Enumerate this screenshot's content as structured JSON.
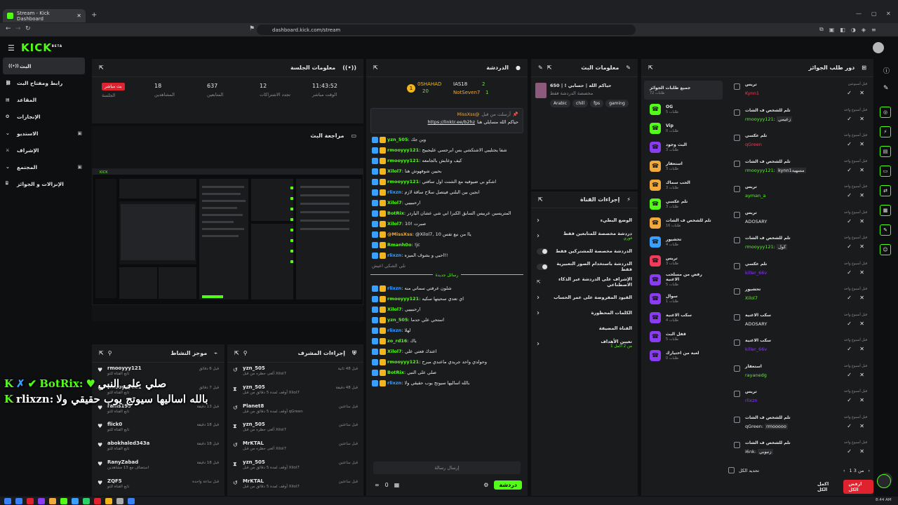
{
  "browser": {
    "tab_title": "Stream - Kick Dashboard",
    "url": "dashboard.kick.com/stream"
  },
  "brand": {
    "logo": "KICK",
    "beta": "BETA",
    "accent": "#53fc18"
  },
  "sidebar": {
    "items": [
      {
        "label": "البث",
        "icon": "broadcast-icon"
      },
      {
        "label": "رابط ومفتاح البث",
        "icon": "link-icon"
      },
      {
        "label": "المقاعد",
        "icon": "seat-icon"
      },
      {
        "label": "الإنجازات",
        "icon": "achievement-icon"
      },
      {
        "label": "الاستديو",
        "icon": "studio-icon"
      },
      {
        "label": "الإشراف",
        "icon": "moderation-icon"
      },
      {
        "label": "المجتمع",
        "icon": "community-icon"
      },
      {
        "label": "الإنزالات و الجوائز",
        "icon": "gift-icon"
      }
    ]
  },
  "session": {
    "title": "معلومات الجلسة",
    "live_badge": "بث مباشر",
    "stats": [
      {
        "label": "الجلسة",
        "value": ""
      },
      {
        "label": "المشاهدين",
        "value": "18"
      },
      {
        "label": "المتابعين",
        "value": "637"
      },
      {
        "label": "تجدد الاشتراكات",
        "value": "12"
      },
      {
        "label": "الوقت مباشر",
        "value": "11:43:52"
      }
    ]
  },
  "preview": {
    "title": "مراجعة البث"
  },
  "activity": {
    "title": "موجز النشاط",
    "items": [
      {
        "user": "rmooyyy121",
        "sub": "تابع القناة للتو",
        "time": "قبل 6 دقائق"
      },
      {
        "user": "rmooyyy121",
        "sub": "تابع القناة للتو",
        "time": "قبل 7 دقائق"
      },
      {
        "user": "rallis199",
        "sub": "تابع القناة للتو",
        "time": "قبل 13 دقيقة"
      },
      {
        "user": "flick0",
        "sub": "تابع القناة للتو",
        "time": "قبل 18 دقيقة"
      },
      {
        "user": "abokhaled343a",
        "sub": "تابع القناة للتو",
        "time": "قبل 18 دقيقة"
      },
      {
        "user": "RanyZabad",
        "sub": "استضاف مع 13 مشاهدين",
        "time": "قبل 18 دقيقة"
      },
      {
        "user": "ZQF5",
        "sub": "تابع القناة للتو",
        "time": "قبل ساعة واحدة"
      }
    ]
  },
  "mod_actions": {
    "title": "إجراءات المشرف",
    "items": [
      {
        "user": "yzn_505",
        "sub": "ألغى حظره من قبل Xilol7",
        "time": "قبل 48 ثانية"
      },
      {
        "user": "yzn_505",
        "sub": "أوقف لمدة 5 دقائق من قبل Xilol7",
        "time": "قبل 48 دقيقة"
      },
      {
        "user": "Planet8",
        "sub": "أوقف لمدة 5 دقائق من قبل qGreen",
        "time": "قبل ساعتين"
      },
      {
        "user": "yzn_505",
        "sub": "ألغى حظره من قبل Xilol7",
        "time": "قبل ساعتين"
      },
      {
        "user": "MrKTAL",
        "sub": "ألغى حظره من قبل Xilol7",
        "time": "قبل ساعتين"
      },
      {
        "user": "yzn_505",
        "sub": "أوقف لمدة 5 دقائق من قبل Xilol7",
        "time": "قبل ساعتين"
      },
      {
        "user": "MrKTAL",
        "sub": "أوقف لمدة 5 دقائق من قبل Xilol7",
        "time": "قبل ساعتين"
      }
    ]
  },
  "chat": {
    "title": "الدردشة",
    "leaders": [
      {
        "name": "0SHAHAD",
        "count": "20"
      },
      {
        "name": "IAS18",
        "count": "2"
      },
      {
        "name": "NotSeven7",
        "count": "1"
      }
    ],
    "pinned_user": "@MissXss",
    "pinned_prefix": "أرسلت من قبل",
    "pinned_text": "حياكم الله مسايلي هنا",
    "pinned_link": "https://linktr.ee/b2hz",
    "new_messages": "رسائل جديدة",
    "messages": [
      {
        "user": "yzn_505",
        "text": "وين جك",
        "color": "#53fc18"
      },
      {
        "user": "rmooyyy121",
        "text": "شفا يجتليبي الاشتكشي بس ابرحسي عليجيبج",
        "color": "#53fc18"
      },
      {
        "user": "rmooyyy121",
        "text": "كيف وعابش بالجامعه",
        "color": "#53fc18"
      },
      {
        "user": "Xilol7",
        "text": "بحيين شوفهوش هنا",
        "color": "#53fc18"
      },
      {
        "user": "rmooyyy121",
        "text": "اشكو بي ضيوفيه مع الشنت اول سافتي",
        "color": "#53fc18"
      },
      {
        "user": "rlixzn",
        "text": "انجين بين البلني فيتصل سلاح ساقة لازم",
        "color": "#3aa0ff"
      },
      {
        "user": "Xilol7",
        "text": "ارحبيييي",
        "color": "#53fc18"
      },
      {
        "user": "BotRix",
        "text": "المتريسين عربيس السابق الكبرا ابي شي عشان الياردر",
        "color": "#53fc18"
      },
      {
        "user": "Xilol7",
        "text": "صبرت !10",
        "color": "#53fc18"
      },
      {
        "user": "@MissXss",
        "text": "@Xilol7, 10 ياا من نبع تفس",
        "color": "#f2a93b"
      },
      {
        "user": "Rmanh0o",
        "text": "!jc",
        "color": "#53fc18"
      },
      {
        "user": "rlixzn",
        "text": "احبي و بشوف الميزه!!",
        "color": "#3aa0ff"
      },
      {
        "user": "",
        "text": "نلي الشكي اعيش",
        "color": "#8c8f93"
      },
      {
        "user": "rlixzn",
        "text": "شلون عرفتي سماتي منه",
        "color": "#3aa0ff"
      },
      {
        "user": "rmooyyy121",
        "text": "اي تعدي سحيتها سكيه",
        "color": "#53fc18"
      },
      {
        "user": "Xilol7",
        "text": "ارحبيييي",
        "color": "#53fc18"
      },
      {
        "user": "yzn_505",
        "text": "استحي علي حدما",
        "color": "#53fc18"
      },
      {
        "user": "rlixzn",
        "text": "لهلا",
        "color": "#3aa0ff"
      },
      {
        "user": "zo_rd16",
        "text": "باك",
        "color": "#53fc18"
      },
      {
        "user": "Xilol7",
        "text": "اعتذك فعتي علي",
        "color": "#53fc18"
      },
      {
        "user": "rmooyyy121",
        "text": "وحولدي واحد جريدي ماعندي مبرح",
        "color": "#53fc18"
      },
      {
        "user": "BotRix",
        "text": "صلي على النبي",
        "color": "#53fc18"
      },
      {
        "user": "rlixzn",
        "text": "بالله اساليها سيوتج يوب حقيقي ولا",
        "color": "#3aa0ff"
      }
    ],
    "input_placeholder": "إرسال رسالة",
    "send_label": "دردشة",
    "footer_count": "0"
  },
  "stream_info": {
    "title": "معلومات البث",
    "stream_title": "حياكم الله | حسابي ! | 650",
    "category": "مخصصة الدردشة فقط",
    "tags": [
      "Arabic",
      "chill",
      "fps",
      "gaming"
    ]
  },
  "channel_actions": {
    "title": "إجراءات القناة",
    "items": [
      {
        "label": "الوضع البطيء",
        "sub": "",
        "control": "chevron"
      },
      {
        "label": "دردشة مخصصة للمتابعين فقط",
        "sub": "فوري",
        "control": "chevron"
      },
      {
        "label": "الدردشة مخصصة للمشتركين فقط",
        "sub": "",
        "control": "toggle"
      },
      {
        "label": "الدردشة باستخدام الصور التعبيرية فقط",
        "sub": "",
        "control": "toggle"
      },
      {
        "label": "الإشراف على الدردشة عبر الذكاء الاصطناعي",
        "sub": "",
        "control": "external"
      },
      {
        "label": "القيود المفروضة على عمر الحساب",
        "sub": "",
        "control": "chevron"
      },
      {
        "label": "الكلمات المحظورة",
        "sub": "",
        "control": "chevron"
      },
      {
        "label": "القناة المضيفة",
        "sub": "",
        "control": "none"
      },
      {
        "label": "تعيين الأهداف",
        "sub": "1 من 2 أكمل",
        "control": "chevron"
      }
    ]
  },
  "queue": {
    "title": "دور طلب الجوائز",
    "categories": [
      {
        "label": "جميع طلبات الجوائز",
        "sub": "72 طلبات",
        "color": "#2a2c2f"
      },
      {
        "label": "OG",
        "sub": "5 طلبات",
        "color": "#53fc18"
      },
      {
        "label": "Vip",
        "sub": "0 طلبات",
        "color": "#53fc18"
      },
      {
        "label": "البث وجود",
        "sub": "3 طلبات",
        "color": "#8a3cf0"
      },
      {
        "label": "استغفار",
        "sub": "3 طلبات",
        "color": "#f2a93b"
      },
      {
        "label": "الحب سماك",
        "sub": "3 طلبات",
        "color": "#f2a93b"
      },
      {
        "label": "تلم عكسي",
        "sub": "3 طلبات",
        "color": "#53fc18"
      },
      {
        "label": "تلم للشخص ف الشات",
        "sub": "16 طلبات",
        "color": "#f2a93b"
      },
      {
        "label": "تحشيور",
        "sub": "4 طلبات",
        "color": "#3aa0ff"
      },
      {
        "label": "تريس",
        "sub": "3 طلبات",
        "color": "#f23b5a"
      },
      {
        "label": "رفض من مسلحب الاغنية",
        "sub": "5 طلبات",
        "color": "#8a3cf0"
      },
      {
        "label": "سوال",
        "sub": "1 طلبات",
        "color": "#8a3cf0"
      },
      {
        "label": "سكب الاغنية",
        "sub": "4 طلبات",
        "color": "#8a3cf0"
      },
      {
        "label": "قفل البث",
        "sub": "5 طلبات",
        "color": "#8a3cf0"
      },
      {
        "label": "لعبة من اختيارك",
        "sub": "0 طلبات",
        "color": "#8a3cf0"
      }
    ],
    "requests": [
      {
        "title": "تريس",
        "user": "Kynn1",
        "user_color": "#f23b5a",
        "extra": "",
        "time": "قبل أسبوعين"
      },
      {
        "title": "تلم للشخص ف الشات",
        "user": "rmooyyy121",
        "user_color": "#53fc18",
        "extra": "زعيمي",
        "time": "قبل أسبوع واحد"
      },
      {
        "title": "تلم عكسي",
        "user": "qGreen",
        "user_color": "#f23b5a",
        "extra": "",
        "time": "قبل أسبوع واحد"
      },
      {
        "title": "تلم للشخص ف الشات",
        "user": "rmooyyy121",
        "user_color": "#53fc18",
        "extra": "kynn1مسهيه",
        "time": "قبل أسبوع واحد"
      },
      {
        "title": "تريس",
        "user": "ayman_a",
        "user_color": "#53fc18",
        "extra": "",
        "time": "قبل أسبوع واحد"
      },
      {
        "title": "تريس",
        "user": "ADOSARY",
        "user_color": "#e8e8e8",
        "extra": "",
        "time": "قبل أسبوع واحد"
      },
      {
        "title": "تلم للشخص ف الشات",
        "user": "rmooyyy121",
        "user_color": "#53fc18",
        "extra": "كول",
        "time": "قبل أسبوع واحد"
      },
      {
        "title": "تلم عكسي",
        "user": "killer_66v",
        "user_color": "#8a3cf0",
        "extra": "",
        "time": "قبل أسبوع واحد"
      },
      {
        "title": "تحشيور",
        "user": "Xilol7",
        "user_color": "#53fc18",
        "extra": "",
        "time": "قبل أسبوع واحد"
      },
      {
        "title": "سكب الاغنية",
        "user": "ADOSARY",
        "user_color": "#e8e8e8",
        "extra": "",
        "time": "قبل أسبوع واحد"
      },
      {
        "title": "سكب الاغنية",
        "user": "killer_66v",
        "user_color": "#8a3cf0",
        "extra": "",
        "time": "قبل أسبوع واحد"
      },
      {
        "title": "استغفار",
        "user": "rayanedg",
        "user_color": "#53fc18",
        "extra": "",
        "time": "قبل أسبوع واحد"
      },
      {
        "title": "تريس",
        "user": "rlixzn",
        "user_color": "#8a3cf0",
        "extra": "",
        "time": "قبل أسبوع واحد"
      },
      {
        "title": "تلم للشخص ف الشات",
        "user": "qGreen",
        "user_color": "#e8e8e8",
        "extra": "rmooooo",
        "time": "قبل أسبوع واحد"
      },
      {
        "title": "تلم للشخص ف الشات",
        "user": "i6nk",
        "user_color": "#e8e8e8",
        "extra": "زنبوبي",
        "time": "قبل أسبوع واحد"
      }
    ],
    "select_all": "تحديد الكل",
    "pagination": "1 من 3",
    "accept_all": "اكمل الكل",
    "reject_all": "ارفض الكل"
  },
  "overlay": {
    "line1_user": "BotRix:",
    "line1_text": "صلي على النبي",
    "line2_user": "rlixzn:",
    "line2_text": "بالله اساليها سيوتج يوب حقيقي ولا"
  },
  "taskbar": {
    "time": "8:44 AM"
  }
}
